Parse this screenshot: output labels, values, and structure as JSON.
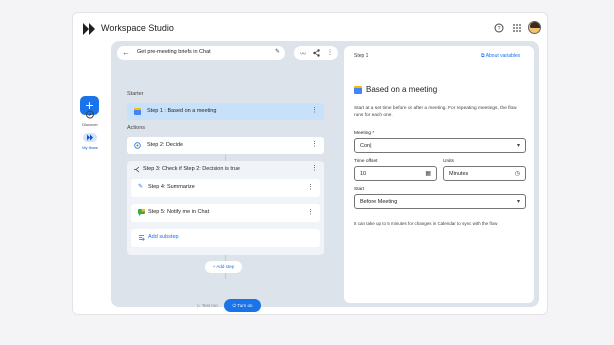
{
  "app": {
    "title": "Workspace Studio"
  },
  "rail": {
    "items": [
      {
        "label": "Discover",
        "icon": "compass-icon"
      },
      {
        "label": "My flows",
        "icon": "flows-icon"
      }
    ]
  },
  "flow": {
    "title": "Get pre-meeting briefs in Chat"
  },
  "sections": {
    "starter": "Starter",
    "actions": "Actions"
  },
  "steps": [
    {
      "label": "Step 1 : Based on a meeting",
      "icon": "calendar-icon"
    },
    {
      "label": "Step 2: Decide",
      "icon": "decide-icon"
    },
    {
      "label": "Step 3: Check if Step 2: Decision is true",
      "icon": "branch-icon"
    },
    {
      "label": "Step 4: Summarize",
      "icon": "edit-icon"
    },
    {
      "label": "Step 5: Notify me in Chat",
      "icon": "chat-icon"
    },
    {
      "label": "Add substep",
      "icon": "add-substep-icon"
    }
  ],
  "buttons": {
    "add_step": "+ Add step",
    "test_run": "Test run",
    "turn_on": "Turn on"
  },
  "panel": {
    "step": "Step 1",
    "about": "About variables",
    "title": "Based on a meeting",
    "description": "Start at a set time before or after a meeting. For repeating meetings, the flow runs for each one.",
    "meeting_label": "Meeting *",
    "meeting_value": "Con|",
    "time_offset_label": "Time offset",
    "time_offset_value": "10",
    "units_label": "Units",
    "units_value": "Minutes",
    "start_label": "Start",
    "start_value": "Before Meeting",
    "note": "It can take up to 5 minutes for changes in Calendar to sync with the flow"
  },
  "colors": {
    "accent": "#1a73e8",
    "active_step": "#c8e1fb",
    "canvas": "#dde3ea"
  }
}
